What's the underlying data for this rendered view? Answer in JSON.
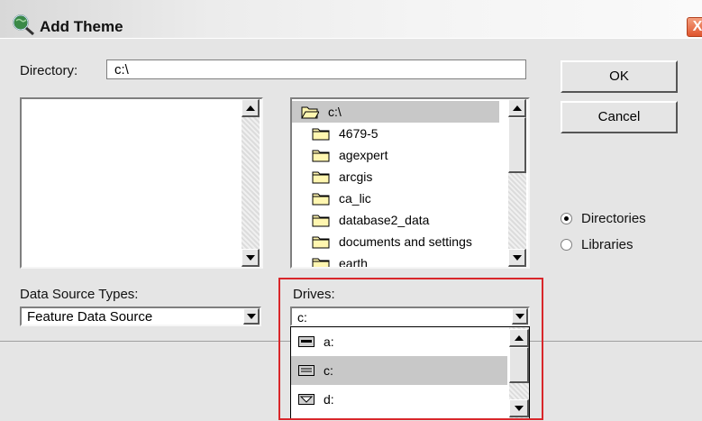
{
  "window": {
    "title": "Add Theme",
    "close_glyph": "X"
  },
  "directory": {
    "label": "Directory:",
    "value": "c:\\"
  },
  "buttons": {
    "ok": "OK",
    "cancel": "Cancel"
  },
  "folders": {
    "current": "c:\\",
    "items": [
      "4679-5",
      "agexpert",
      "arcgis",
      "ca_lic",
      "database2_data",
      "documents and settings",
      "earth"
    ]
  },
  "view_mode": {
    "options": [
      {
        "label": "Directories",
        "selected": true
      },
      {
        "label": "Libraries",
        "selected": false
      }
    ]
  },
  "data_source": {
    "label": "Data Source Types:",
    "value": "Feature Data Source"
  },
  "drives": {
    "label": "Drives:",
    "value": "c:",
    "options": [
      {
        "label": "a:",
        "icon": "floppy-drive-icon",
        "selected": false
      },
      {
        "label": "c:",
        "icon": "hard-drive-icon",
        "selected": true
      },
      {
        "label": "d:",
        "icon": "cd-drive-icon",
        "selected": false
      }
    ]
  },
  "colors": {
    "highlight": "#c8c8c8",
    "annotation": "#d9262a",
    "dialog_bg": "#e5e5e5"
  }
}
